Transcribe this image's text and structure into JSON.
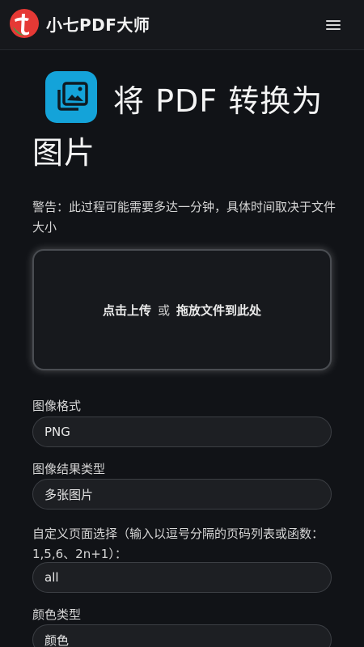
{
  "header": {
    "brand": "小七PDF大师",
    "logo_colors": {
      "circle": "#e53935",
      "mark": "#ffffff",
      "leaf": "#43a047"
    },
    "menu_icon": "hamburger-menu-icon"
  },
  "tool": {
    "icon": "images-icon",
    "icon_color": "#14a3d9",
    "title_line1": "将 PDF 转换为",
    "title_line2": "图片"
  },
  "warning": "警告：此过程可能需要多达一分钟，具体时间取决于文件大小",
  "dropzone": {
    "click_upload": "点击上传",
    "or": "或",
    "drag_drop": "拖放文件到此处"
  },
  "form": {
    "image_format": {
      "label": "图像格式",
      "value": "PNG"
    },
    "result_type": {
      "label": "图像结果类型",
      "value": "多张图片"
    },
    "page_select": {
      "label": "自定义页面选择（输入以逗号分隔的页码列表或函数：1,5,6、2n+1）：",
      "value": "all"
    },
    "color_type": {
      "label": "颜色类型",
      "value": "颜色"
    }
  },
  "colors": {
    "background": "#111317",
    "navbar": "#16181c",
    "field_bg": "#1d1f23",
    "field_border": "#3c3f44"
  }
}
